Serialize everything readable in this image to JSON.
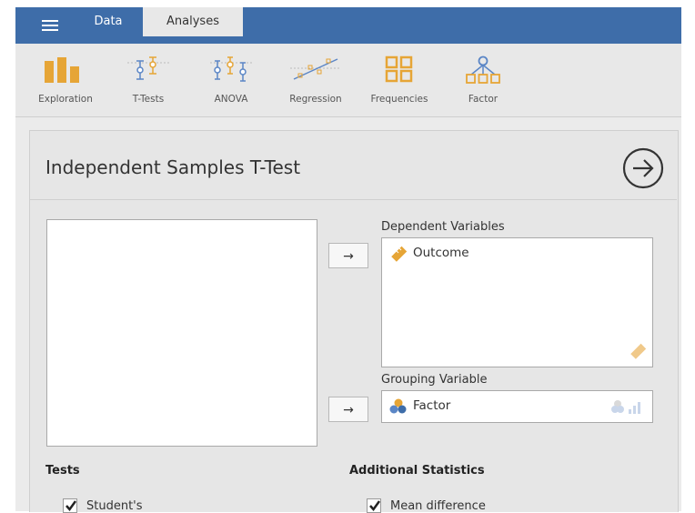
{
  "tabs": {
    "data": "Data",
    "analyses": "Analyses"
  },
  "ribbon": [
    {
      "label": "Exploration",
      "icon": "exploration-icon"
    },
    {
      "label": "T-Tests",
      "icon": "t-tests-icon"
    },
    {
      "label": "ANOVA",
      "icon": "anova-icon"
    },
    {
      "label": "Regression",
      "icon": "regression-icon"
    },
    {
      "label": "Frequencies",
      "icon": "frequencies-icon"
    },
    {
      "label": "Factor",
      "icon": "factor-icon"
    }
  ],
  "panel": {
    "title": "Independent Samples T-Test"
  },
  "dependent": {
    "label": "Dependent Variables",
    "items": [
      "Outcome"
    ]
  },
  "grouping": {
    "label": "Grouping Variable",
    "value": "Factor"
  },
  "move_arrow": "→",
  "tests": {
    "heading": "Tests",
    "options": [
      {
        "label": "Student's",
        "checked": true
      }
    ]
  },
  "additional": {
    "heading": "Additional Statistics",
    "options": [
      {
        "label": "Mean difference",
        "checked": true
      }
    ]
  },
  "colors": {
    "topbar": "#3e6da9",
    "icon_orange": "#e6a536",
    "icon_blue": "#5b86c6",
    "ribbon_bg": "#e8e8e8"
  }
}
